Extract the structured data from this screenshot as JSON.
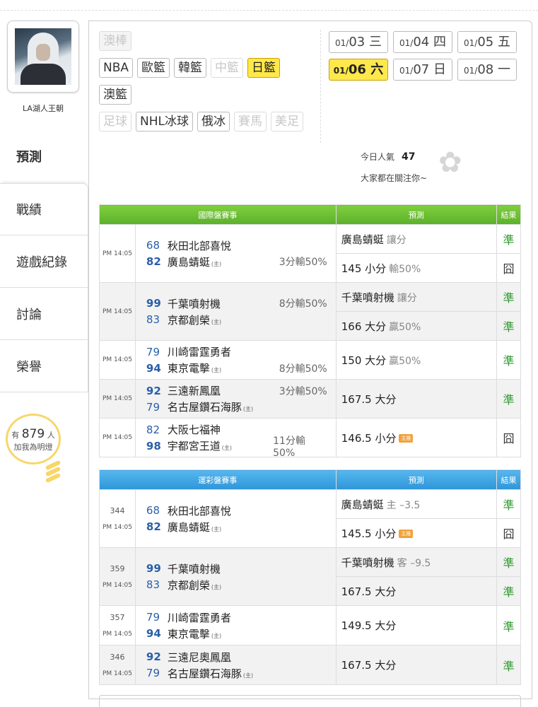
{
  "user": {
    "name": "LA湖人王朝"
  },
  "sidebar": {
    "items": [
      {
        "label": "預測"
      },
      {
        "label": "戰績"
      },
      {
        "label": "遊戲紀錄"
      },
      {
        "label": "討論"
      },
      {
        "label": "榮譽"
      }
    ]
  },
  "lamp": {
    "prefix": "有",
    "count": "879",
    "suffix": "人",
    "line2": "加我為明燈"
  },
  "sports": {
    "row1": [
      "澳棒"
    ],
    "row2": [
      "NBA",
      "歐籃",
      "韓籃",
      "中籃",
      "日籃"
    ],
    "row3": [
      "澳籃"
    ],
    "row4": [
      "足球",
      "NHL冰球",
      "俄冰",
      "賽馬",
      "美足"
    ],
    "active": "日籃",
    "disabled": [
      "澳棒",
      "中籃",
      "足球",
      "賽馬",
      "美足"
    ]
  },
  "dates": [
    {
      "md": "01/",
      "d": "03",
      "w": "三"
    },
    {
      "md": "01/",
      "d": "04",
      "w": "四"
    },
    {
      "md": "01/",
      "d": "05",
      "w": "五"
    },
    {
      "md": "01/",
      "d": "06",
      "w": "六"
    },
    {
      "md": "01/",
      "d": "07",
      "w": "日"
    },
    {
      "md": "01/",
      "d": "08",
      "w": "一"
    }
  ],
  "popularity": {
    "label": "今日人氣",
    "value": "47",
    "note": "大家都在關注你~"
  },
  "intl": {
    "headers": [
      "國際盤賽事",
      "預測",
      "結果"
    ],
    "games": [
      {
        "time": "PM 14:05",
        "t1": {
          "score": "68",
          "name": "秋田北部喜悅"
        },
        "t2": {
          "score": "82",
          "name": "廣島蜻蜓",
          "home": "(主)",
          "hc": "3分輸50%"
        },
        "preds": [
          {
            "main": "廣島蜻蜓",
            "sub": "讓分",
            "res": "準"
          },
          {
            "main": "145 小分",
            "sub": "輸50%",
            "res": "囧"
          }
        ]
      },
      {
        "time": "PM 14:05",
        "t1": {
          "score": "99",
          "name": "千葉噴射機",
          "hc": "8分輸50%"
        },
        "t2": {
          "score": "83",
          "name": "京都創榮",
          "home": "(主)"
        },
        "preds": [
          {
            "main": "千葉噴射機",
            "sub": "讓分",
            "res": "準"
          },
          {
            "main": "166 大分",
            "sub": "贏50%",
            "res": "準"
          }
        ]
      },
      {
        "time": "PM 14:05",
        "t1": {
          "score": "79",
          "name": "川崎雷霆勇者"
        },
        "t2": {
          "score": "94",
          "name": "東京電擊",
          "home": "(主)",
          "hc": "8分輸50%"
        },
        "preds": [
          {
            "main": "150 大分",
            "sub": "贏50%",
            "res": "準"
          }
        ]
      },
      {
        "time": "PM 14:05",
        "t1": {
          "score": "92",
          "name": "三遠新鳳凰",
          "hc": "3分輸50%"
        },
        "t2": {
          "score": "79",
          "name": "名古屋鑽石海豚",
          "home": "(主)"
        },
        "preds": [
          {
            "main": "167.5 大分",
            "sub": "",
            "res": "準"
          }
        ]
      },
      {
        "time": "PM 14:05",
        "t1": {
          "score": "82",
          "name": "大阪七福神"
        },
        "t2": {
          "score": "98",
          "name": "宇都宮王道",
          "home": "(主)",
          "hc": "11分輸50%"
        },
        "preds": [
          {
            "main": "146.5 小分",
            "sub": "",
            "tag": "主推",
            "res": "囧"
          }
        ]
      }
    ]
  },
  "lottery": {
    "headers": [
      "運彩盤賽事",
      "預測",
      "結果"
    ],
    "games": [
      {
        "id": "344",
        "time": "PM 14:05",
        "t1": {
          "score": "68",
          "name": "秋田北部喜悅"
        },
        "t2": {
          "score": "82",
          "name": "廣島蜻蜓",
          "home": "(主)"
        },
        "preds": [
          {
            "main": "廣島蜻蜓",
            "sub": "主 –3.5",
            "res": "準"
          },
          {
            "main": "145.5 小分",
            "sub": "",
            "tag": "主推",
            "res": "囧"
          }
        ]
      },
      {
        "id": "359",
        "time": "PM 14:05",
        "t1": {
          "score": "99",
          "name": "千葉噴射機"
        },
        "t2": {
          "score": "83",
          "name": "京都創榮",
          "home": "(主)"
        },
        "preds": [
          {
            "main": "千葉噴射機",
            "sub": "客 –9.5",
            "res": "準"
          },
          {
            "main": "167.5 大分",
            "sub": "",
            "res": "準"
          }
        ]
      },
      {
        "id": "357",
        "time": "PM 14:05",
        "t1": {
          "score": "79",
          "name": "川崎雷霆勇者"
        },
        "t2": {
          "score": "94",
          "name": "東京電擊",
          "home": "(主)"
        },
        "preds": [
          {
            "main": "149.5 大分",
            "sub": "",
            "res": "準"
          }
        ]
      },
      {
        "id": "346",
        "time": "PM 14:05",
        "t1": {
          "score": "92",
          "name": "三遠尼奧鳳凰"
        },
        "t2": {
          "score": "79",
          "name": "名古屋鑽石海豚",
          "home": "(主)"
        },
        "preds": [
          {
            "main": "167.5 大分",
            "sub": "",
            "res": "準"
          }
        ]
      }
    ]
  },
  "colors": {
    "accent": "#ffe84a",
    "green": "#5cb02a",
    "blue": "#2e95d8",
    "ok": "#2f9a2f"
  }
}
